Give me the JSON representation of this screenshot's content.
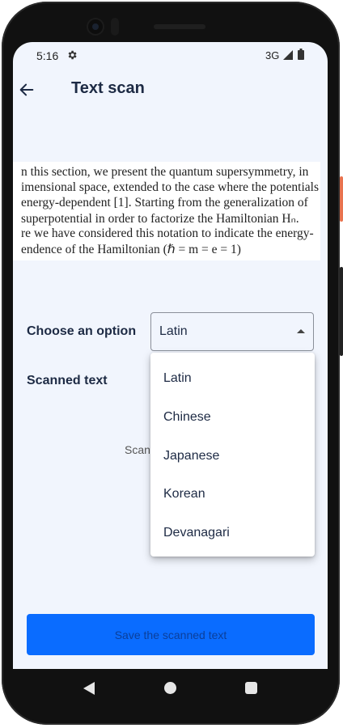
{
  "status_bar": {
    "time": "5:16",
    "network": "3G"
  },
  "app_bar": {
    "title": "Text scan"
  },
  "scan_image": {
    "lines": [
      "n this section, we present the quantum supersymmetry, in",
      "imensional space, extended to the case where the potentials",
      " energy-dependent [1]. Starting from the generalization of",
      " superpotential in order to factorize the Hamiltonian Hₙ.",
      "re we have considered this notation to indicate the energy-",
      "endence of the Hamiltonian (ℏ = m = e = 1)"
    ]
  },
  "form": {
    "choose_label": "Choose an option",
    "selected_value": "Latin",
    "scanned_label": "Scanned text",
    "hint_partial": "Scan"
  },
  "dropdown": {
    "options": [
      "Latin",
      "Chinese",
      "Japanese",
      "Korean",
      "Devanagari"
    ]
  },
  "actions": {
    "save_label": "Save the scanned text"
  },
  "colors": {
    "accent": "#0a6cff",
    "background": "#f1f5fd",
    "title": "#1d2a44"
  }
}
